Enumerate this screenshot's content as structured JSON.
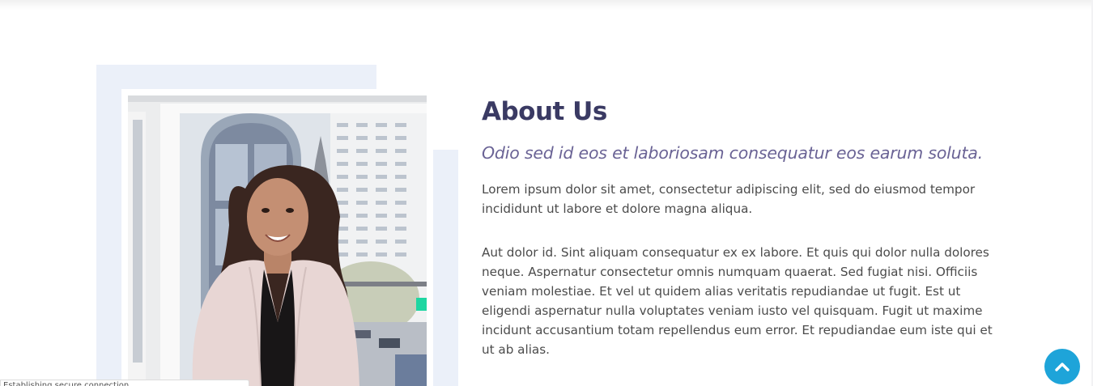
{
  "about": {
    "title": "About Us",
    "subtitle": "Odio sed id eos et laboriosam consequatur eos earum soluta.",
    "paragraph_1": "Lorem ipsum dolor sit amet, consectetur adipiscing elit, sed do eiusmod tempor incididunt ut labore et dolore magna aliqua.",
    "paragraph_2": "Aut dolor id. Sint aliquam consequatur ex ex labore. Et quis qui dolor nulla dolores neque. Aspernatur consectetur omnis numquam quaerat. Sed fugiat nisi. Officiis veniam molestiae. Et vel ut quidem alias veritatis repudiandae ut fugit. Est ut eligendi aspernatur nulla voluptates veniam iusto vel quisquam. Fugit ut maxime incidunt accusantium totam repellendus eum error. Et repudiandae eum iste qui et ut ab alias."
  },
  "image": {
    "icon": "person-photo"
  },
  "scroll_top": {
    "icon": "chevron-up-icon"
  },
  "status_bar": {
    "text": "Establishing secure connection..."
  },
  "colors": {
    "title": "#3a3a63",
    "subtitle": "#6a6395",
    "body_text": "#4b4b4b",
    "frame": "#ebf0f9",
    "accent": "#1ea4d9"
  }
}
